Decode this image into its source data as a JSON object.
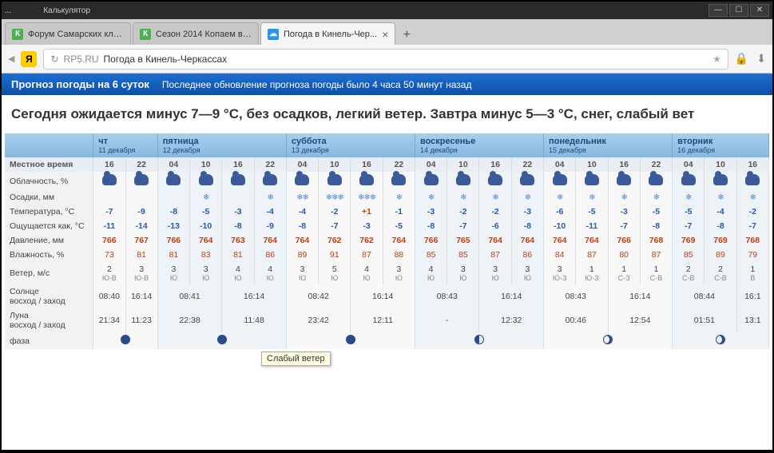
{
  "window": {
    "title_left": "...",
    "title_left2": "Калькулятор"
  },
  "tabs": [
    {
      "favicon": "К",
      "label": "Форум Самарских кла..."
    },
    {
      "favicon": "К",
      "label": "Сезон 2014 Копаем вм..."
    },
    {
      "favicon": "w",
      "label": "Погода в Кинель-Чер..."
    }
  ],
  "address": {
    "domain": "RP5.RU",
    "title": "Погода в Кинель-Черкассах"
  },
  "banner": {
    "title": "Прогноз погоды на 6 суток",
    "subtitle": "Последнее обновление прогноза погоды было 4 часа 50 минут назад"
  },
  "summary": "Сегодня ожидается минус 7—9 °С, без осадков, легкий ветер. Завтра минус 5—3 °С, снег, слабый вет",
  "tooltip": "Слабый ветер",
  "days": [
    {
      "head": "чт\n11 декабря",
      "cols": 2
    },
    {
      "head": "пятница\n12 декабря",
      "cols": 4
    },
    {
      "head": "суббота\n13 декабря",
      "cols": 4
    },
    {
      "head": "воскресенье\n14 декабря",
      "cols": 4
    },
    {
      "head": "понедельник\n15 декабря",
      "cols": 4
    },
    {
      "head": "вторник\n16 декабря",
      "cols": 3
    }
  ],
  "rows": {
    "time_label": "Местное время",
    "time": [
      "16",
      "22",
      "04",
      "10",
      "16",
      "22",
      "04",
      "10",
      "16",
      "22",
      "04",
      "10",
      "16",
      "22",
      "04",
      "10",
      "16",
      "22",
      "04",
      "10",
      "16"
    ],
    "cloud_label": "Облачность, %",
    "precip_label": "Осадки, мм",
    "precip": [
      "",
      "",
      "",
      "*",
      "",
      "*",
      "**",
      "***",
      "***",
      "*",
      "*",
      "*",
      "*",
      "*",
      "*",
      "*",
      "*",
      "*",
      "*",
      "*",
      "*"
    ],
    "temp_label": "Температура, °С",
    "temp": [
      "-7",
      "-9",
      "-8",
      "-5",
      "-3",
      "-4",
      "-4",
      "-2",
      "+1",
      "-1",
      "-3",
      "-2",
      "-2",
      "-3",
      "-6",
      "-5",
      "-3",
      "-5",
      "-5",
      "-4",
      "-2"
    ],
    "feel_label": "Ощущается как, °С",
    "feel": [
      "-11",
      "-14",
      "-13",
      "-10",
      "-8",
      "-9",
      "-8",
      "-7",
      "-3",
      "-5",
      "-8",
      "-7",
      "-6",
      "-8",
      "-10",
      "-11",
      "-7",
      "-8",
      "-7",
      "-8",
      "-7"
    ],
    "press_label": "Давление, мм",
    "press": [
      "766",
      "767",
      "766",
      "764",
      "763",
      "764",
      "764",
      "762",
      "762",
      "764",
      "766",
      "765",
      "764",
      "764",
      "764",
      "764",
      "766",
      "768",
      "769",
      "769",
      "768"
    ],
    "hum_label": "Влажность, %",
    "hum": [
      "73",
      "81",
      "81",
      "83",
      "81",
      "86",
      "89",
      "91",
      "87",
      "88",
      "85",
      "85",
      "87",
      "86",
      "84",
      "87",
      "80",
      "87",
      "85",
      "89",
      "79"
    ],
    "wind_label": "Ветер, м/с",
    "wind_spd": [
      "2",
      "3",
      "3",
      "3",
      "4",
      "4",
      "3",
      "5",
      "4",
      "3",
      "4",
      "3",
      "3",
      "3",
      "3",
      "1",
      "1",
      "1",
      "2",
      "2",
      "1"
    ],
    "wind_dir": [
      "Ю-В",
      "Ю-В",
      "Ю",
      "Ю",
      "Ю",
      "Ю",
      "Ю",
      "Ю",
      "Ю",
      "Ю",
      "Ю",
      "Ю",
      "Ю",
      "Ю",
      "Ю-З",
      "Ю-З",
      "С-З",
      "С-В",
      "С-В",
      "С-В",
      "В"
    ],
    "sun_label": "Солнце\nвосход / заход",
    "sun": [
      "08:40",
      "16:14",
      "08:41",
      "16:14",
      "08:42",
      "16:14",
      "08:43",
      "16:14",
      "08:43",
      "16:14",
      "08:44",
      "16:1"
    ],
    "moon_label": "Луна\nвосход / заход",
    "moon": [
      "21:34",
      "11:23",
      "22:38",
      "11:48",
      "23:42",
      "12:11",
      "-",
      "12:32",
      "00:46",
      "12:54",
      "01:51",
      "13:1"
    ],
    "phase_label": "фаза"
  }
}
